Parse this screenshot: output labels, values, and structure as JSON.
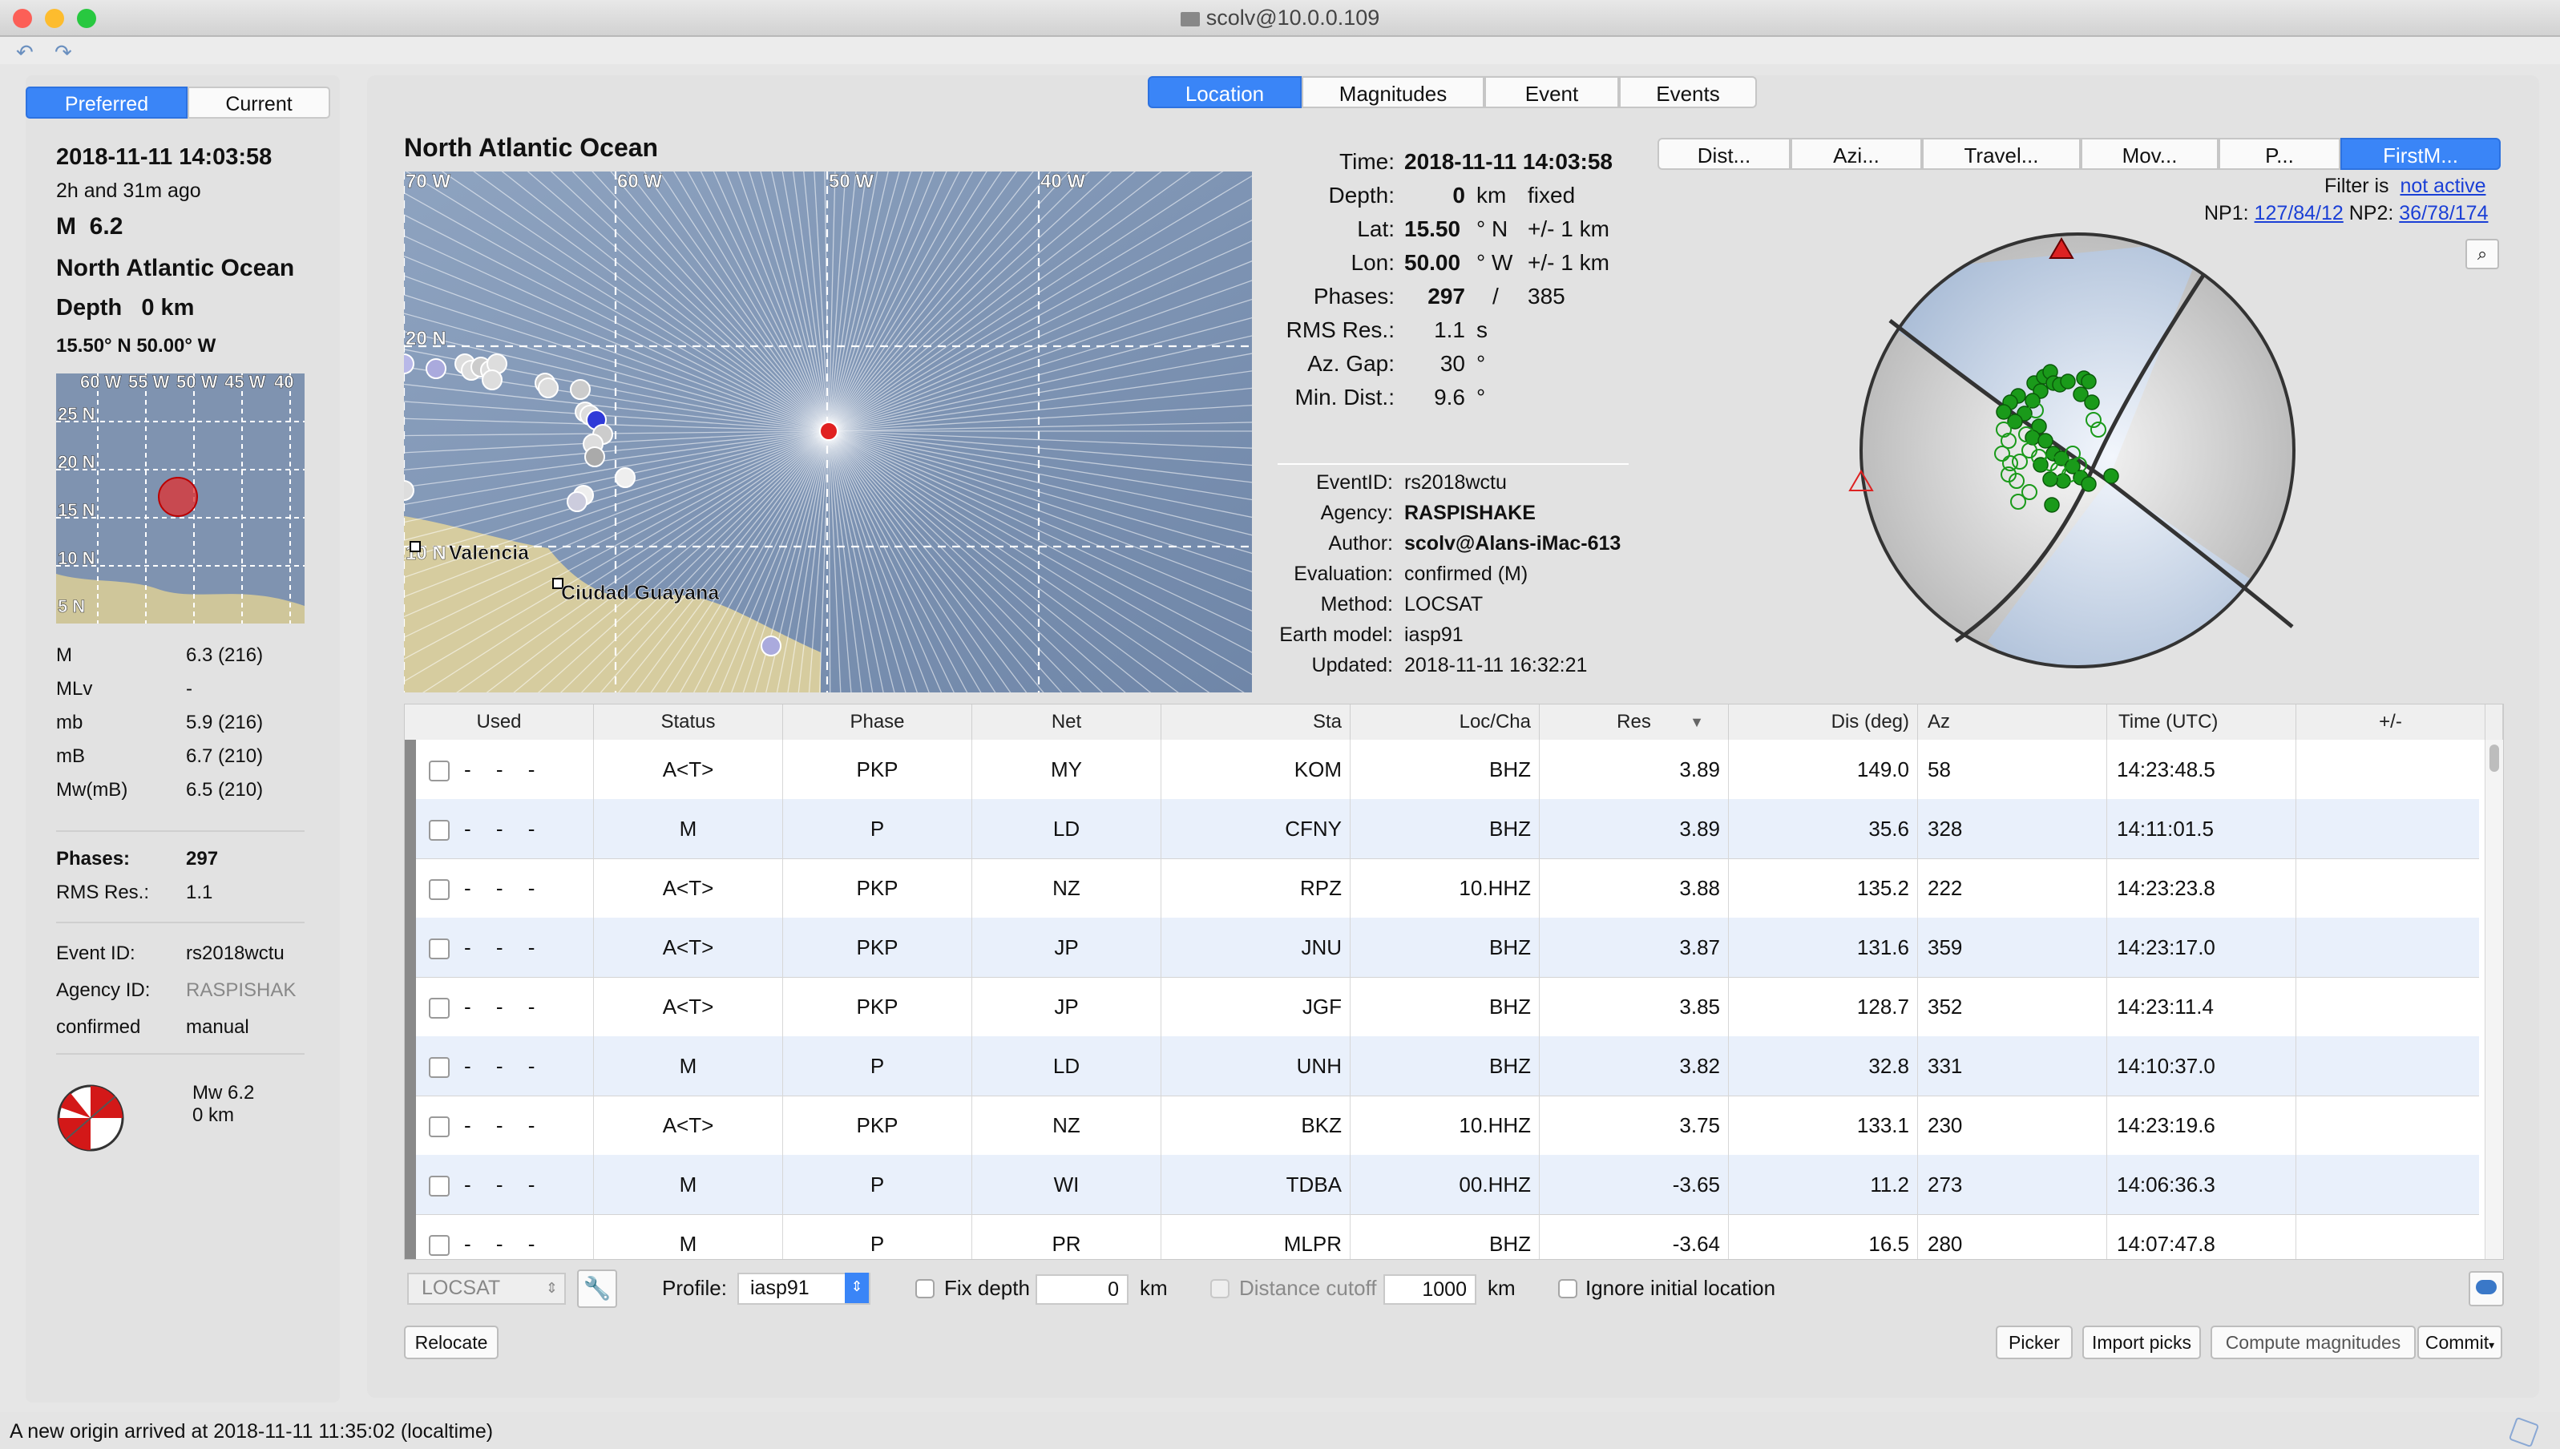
{
  "window": {
    "title": "scolv@10.0.0.109"
  },
  "left": {
    "seg_preferred": "Preferred",
    "seg_current": "Current",
    "datetime": "2018-11-11 14:03:58",
    "ago": "2h and 31m ago",
    "mag_label": "M",
    "mag_value": "6.2",
    "region": "North Atlantic Ocean",
    "depth_label": "Depth",
    "depth_value": "0 km",
    "latlon": "15.50° N   50.00° W",
    "minimap_labels": [
      "60 W",
      "55 W",
      "50 W",
      "45 W",
      "40",
      "25 N",
      "20 N",
      "15 N",
      "10 N",
      "5 N"
    ],
    "magnitudes": [
      {
        "k": "M",
        "v": "6.3 (216)"
      },
      {
        "k": "MLv",
        "v": "-"
      },
      {
        "k": "mb",
        "v": "5.9 (216)"
      },
      {
        "k": "mB",
        "v": "6.7 (210)"
      },
      {
        "k": "Mw(mB)",
        "v": "6.5 (210)"
      }
    ],
    "phases_label": "Phases:",
    "phases_value": "297",
    "rms_label": "RMS Res.:",
    "rms_value": "1.1",
    "eventid_label": "Event ID:",
    "eventid_value": "rs2018wctu",
    "agency_label": "Agency ID:",
    "agency_value": "RASPISHAK",
    "eval_status": "confirmed",
    "eval_mode": "manual",
    "fm_mag": "Mw 6.2",
    "fm_depth": "0 km"
  },
  "tabs": {
    "location": "Location",
    "magnitudes": "Magnitudes",
    "event": "Event",
    "events": "Events"
  },
  "map": {
    "title": "North Atlantic Ocean",
    "lon_labels": [
      "70 W",
      "60 W",
      "50 W",
      "40 W"
    ],
    "lat_labels": [
      "20 N",
      "10 N"
    ],
    "cities": [
      "Valencia",
      "Ciudad Guayana"
    ]
  },
  "origin": {
    "time_label": "Time:",
    "time_value": "2018-11-11 14:03:58",
    "depth_label": "Depth:",
    "depth_value": "0",
    "depth_unit": "km",
    "depth_type": "fixed",
    "lat_label": "Lat:",
    "lat_value": "15.50",
    "lat_unit": "° N",
    "lat_err": "+/- 1  km",
    "lon_label": "Lon:",
    "lon_value": "50.00",
    "lon_unit": "° W",
    "lon_err": "+/- 1  km",
    "phases_label": "Phases:",
    "phases_used": "297",
    "phases_sep": "/",
    "phases_total": "385",
    "rms_label": "RMS Res.:",
    "rms_value": "1.1",
    "rms_unit": "s",
    "azgap_label": "Az. Gap:",
    "azgap_value": "30",
    "azgap_unit": "°",
    "mindist_label": "Min. Dist.:",
    "mindist_value": "9.6",
    "mindist_unit": "°"
  },
  "event": {
    "eventid_label": "EventID:",
    "eventid_value": "rs2018wctu",
    "agency_label": "Agency:",
    "agency_value": "RASPISHAKE",
    "author_label": "Author:",
    "author_value": "scolv@Alans-iMac-613",
    "evaluation_label": "Evaluation:",
    "evaluation_value": "confirmed (M)",
    "method_label": "Method:",
    "method_value": "LOCSAT",
    "earthmodel_label": "Earth model:",
    "earthmodel_value": "iasp91",
    "updated_label": "Updated:",
    "updated_value": "2018-11-11 16:32:21"
  },
  "plot_tabs": [
    "Dist...",
    "Azi...",
    "Travel...",
    "Mov...",
    "P...",
    "FirstM..."
  ],
  "filter": {
    "label": "Filter is",
    "link": "not active"
  },
  "np": {
    "np1_label": "NP1:",
    "np1_value": "127/84/12",
    "np2_label": "NP2:",
    "np2_value": "36/78/174"
  },
  "table": {
    "headers": [
      "Used",
      "Status",
      "Phase",
      "Net",
      "Sta",
      "Loc/Cha",
      "Res",
      "Dis (deg)",
      "Az",
      "Time (UTC)",
      "+/-"
    ],
    "rows": [
      {
        "used": "- - -",
        "status": "A<T>",
        "phase": "PKP",
        "net": "MY",
        "sta": "KOM",
        "loccha": "BHZ",
        "res": "3.89",
        "dis": "149.0",
        "az": "58",
        "time": "14:23:48.5"
      },
      {
        "used": "- - -",
        "status": "M",
        "phase": "P",
        "net": "LD",
        "sta": "CFNY",
        "loccha": "BHZ",
        "res": "3.89",
        "dis": "35.6",
        "az": "328",
        "time": "14:11:01.5"
      },
      {
        "used": "- - -",
        "status": "A<T>",
        "phase": "PKP",
        "net": "NZ",
        "sta": "RPZ",
        "loccha": "10.HHZ",
        "res": "3.88",
        "dis": "135.2",
        "az": "222",
        "time": "14:23:23.8"
      },
      {
        "used": "- - -",
        "status": "A<T>",
        "phase": "PKP",
        "net": "JP",
        "sta": "JNU",
        "loccha": "BHZ",
        "res": "3.87",
        "dis": "131.6",
        "az": "359",
        "time": "14:23:17.0"
      },
      {
        "used": "- - -",
        "status": "A<T>",
        "phase": "PKP",
        "net": "JP",
        "sta": "JGF",
        "loccha": "BHZ",
        "res": "3.85",
        "dis": "128.7",
        "az": "352",
        "time": "14:23:11.4"
      },
      {
        "used": "- - -",
        "status": "M",
        "phase": "P",
        "net": "LD",
        "sta": "UNH",
        "loccha": "BHZ",
        "res": "3.82",
        "dis": "32.8",
        "az": "331",
        "time": "14:10:37.0"
      },
      {
        "used": "- - -",
        "status": "A<T>",
        "phase": "PKP",
        "net": "NZ",
        "sta": "BKZ",
        "loccha": "10.HHZ",
        "res": "3.75",
        "dis": "133.1",
        "az": "230",
        "time": "14:23:19.6"
      },
      {
        "used": "- - -",
        "status": "M",
        "phase": "P",
        "net": "WI",
        "sta": "TDBA",
        "loccha": "00.HHZ",
        "res": "-3.65",
        "dis": "11.2",
        "az": "273",
        "time": "14:06:36.3"
      },
      {
        "used": "- - -",
        "status": "M",
        "phase": "P",
        "net": "PR",
        "sta": "MLPR",
        "loccha": "BHZ",
        "res": "-3.64",
        "dis": "16.5",
        "az": "280",
        "time": "14:07:47.8"
      }
    ]
  },
  "controls": {
    "locator": "LOCSAT",
    "profile_label": "Profile:",
    "profile_value": "iasp91",
    "fixdepth_label": "Fix depth",
    "fixdepth_value": "0",
    "fixdepth_unit": "km",
    "distcutoff_label": "Distance cutoff",
    "distcutoff_value": "1000",
    "distcutoff_unit": "km",
    "ignore_label": "Ignore initial location",
    "relocate": "Relocate",
    "picker": "Picker",
    "import_picks": "Import picks",
    "compute_magnitudes": "Compute magnitudes",
    "commit": "Commit"
  },
  "status": {
    "message": "A new origin arrived at 2018-11-11 11:35:02 (localtime)"
  },
  "colors": {
    "accent": "#3a85f7",
    "epicenter": "#e02020",
    "polarity_up": "#1a9a1a"
  }
}
